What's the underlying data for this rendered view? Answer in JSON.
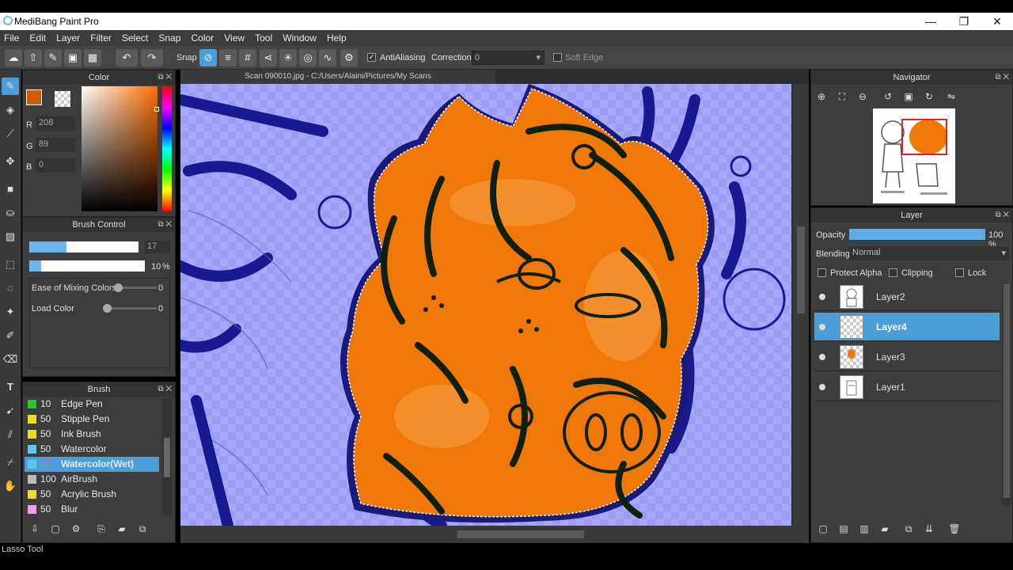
{
  "window": {
    "title": "MediBang Paint Pro"
  },
  "menu": [
    "File",
    "Edit",
    "Layer",
    "Filter",
    "Select",
    "Snap",
    "Color",
    "View",
    "Tool",
    "Window",
    "Help"
  ],
  "toolbar": {
    "snap_label": "Snap",
    "antialiasing_label": "AntiAliasing",
    "correction_label": "Correction",
    "correction_value": "0",
    "soft_edge_label": "Soft Edge"
  },
  "color_panel": {
    "title": "Color",
    "r_label": "R",
    "r_value": "208",
    "g_label": "G",
    "g_value": "89",
    "b_label": "B",
    "b_value": "0",
    "primary_color": "#d05900"
  },
  "brush_control": {
    "title": "Brush Control",
    "size_value": "17",
    "opacity_value": "10",
    "opacity_unit": "%",
    "ease_label": "Ease of Mixing Colors",
    "ease_value": "0",
    "load_label": "Load Color",
    "load_value": "0"
  },
  "brush_panel": {
    "title": "Brush",
    "items": [
      {
        "size": "10",
        "name": "Edge Pen",
        "color": "#22cc22"
      },
      {
        "size": "50",
        "name": "Stipple Pen",
        "color": "#e8e020"
      },
      {
        "size": "50",
        "name": "Ink Brush",
        "color": "#e8e020"
      },
      {
        "size": "50",
        "name": "Watercolor",
        "color": "#5cc8f0"
      },
      {
        "size": "17",
        "name": "Watercolor(Wet)",
        "color": "#5cc8f0"
      },
      {
        "size": "100",
        "name": "AirBrush",
        "color": "#bbbbbb"
      },
      {
        "size": "50",
        "name": "Acrylic Brush",
        "color": "#e8e020"
      },
      {
        "size": "50",
        "name": "Blur",
        "color": "#f0a0e0"
      }
    ]
  },
  "canvas": {
    "tab_label": "Scan 090010.jpg - C:/Users/Alaini/Pictures/My Scans"
  },
  "navigator": {
    "title": "Navigator"
  },
  "layer_panel": {
    "title": "Layer",
    "opacity_label": "Opacity",
    "opacity_value": "100 %",
    "opacity_fraction": 1.0,
    "blending_label": "Blending",
    "blending_value": "Normal",
    "protect_alpha_label": "Protect Alpha",
    "clipping_label": "Clipping",
    "lock_label": "Lock",
    "layers": [
      "Layer2",
      "Layer4",
      "Layer3",
      "Layer1"
    ]
  },
  "status": {
    "text": "Lasso Tool"
  }
}
